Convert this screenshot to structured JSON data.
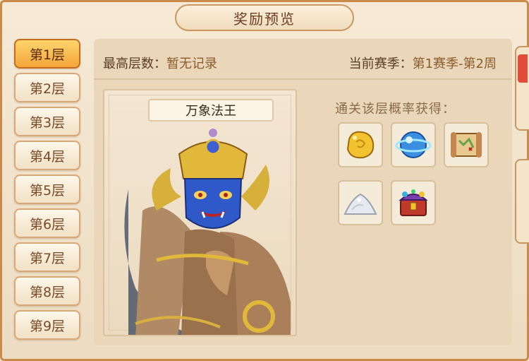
{
  "header": {
    "title": "奖励预览"
  },
  "tabs": [
    {
      "label": "第1层",
      "active": true
    },
    {
      "label": "第2层",
      "active": false
    },
    {
      "label": "第3层",
      "active": false
    },
    {
      "label": "第4层",
      "active": false
    },
    {
      "label": "第5层",
      "active": false
    },
    {
      "label": "第6层",
      "active": false
    },
    {
      "label": "第7层",
      "active": false
    },
    {
      "label": "第8层",
      "active": false
    },
    {
      "label": "第9层",
      "active": false
    }
  ],
  "stats": {
    "best_label": "最高层数：",
    "best_value": "暂无记录",
    "season_label": "当前赛季：",
    "season_value": "第1赛季-第2周"
  },
  "boss": {
    "name": "万象法王"
  },
  "rewards": {
    "title": "通关该层概率获得：",
    "items": [
      {
        "icon": "gold-ore-icon"
      },
      {
        "icon": "blue-orb-icon"
      },
      {
        "icon": "treasure-map-icon"
      },
      {
        "icon": "silver-powder-icon"
      },
      {
        "icon": "treasure-chest-icon"
      }
    ]
  },
  "colors": {
    "accent": "#f3a53a",
    "border": "#c98a4a",
    "panel": "#ead7b9",
    "text_dark": "#5a3c22",
    "text_value": "#8a5c2c"
  }
}
